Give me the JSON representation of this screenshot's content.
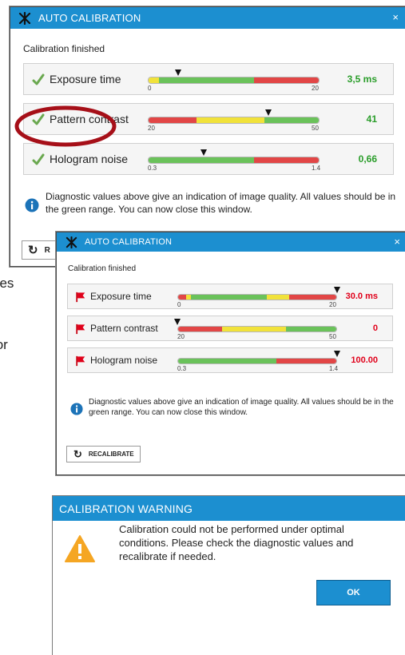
{
  "colors": {
    "accent": "#1c8fd0",
    "good": "#2a9d2a",
    "bad": "#e0001a",
    "green": "#6ac25a",
    "yellow": "#f1e23a",
    "red": "#e24646",
    "annotation": "#a60f18"
  },
  "side_text": {
    "line1": "ues",
    "line2": "for"
  },
  "dialog1": {
    "title": "AUTO CALIBRATION",
    "close": "×",
    "subtitle": "Calibration finished",
    "rows": [
      {
        "label": "Exposure time",
        "status_icon": "check-icon",
        "value": "3,5 ms",
        "value_color": "#2a9d2a",
        "min": 0,
        "max": 20,
        "min_label": "0",
        "max_label": "20",
        "marker": 3.5,
        "segments": [
          {
            "c": "yellow",
            "w": 0.06
          },
          {
            "c": "green",
            "w": 0.56
          },
          {
            "c": "red",
            "w": 0.38
          }
        ]
      },
      {
        "label": "Pattern contrast",
        "status_icon": "check-icon",
        "value": "41",
        "value_color": "#2a9d2a",
        "min": 20,
        "max": 50,
        "min_label": "20",
        "max_label": "50",
        "marker": 41,
        "segments": [
          {
            "c": "red",
            "w": 0.28
          },
          {
            "c": "yellow",
            "w": 0.4
          },
          {
            "c": "green",
            "w": 0.32
          }
        ]
      },
      {
        "label": "Hologram noise",
        "status_icon": "check-icon",
        "value": "0,66",
        "value_color": "#2a9d2a",
        "min": 0.3,
        "max": 1.4,
        "min_label": "0.3",
        "max_label": "1.4",
        "marker": 0.66,
        "segments": [
          {
            "c": "green",
            "w": 0.62
          },
          {
            "c": "red",
            "w": 0.38
          }
        ]
      }
    ],
    "info": "Diagnostic values above give an indication of image quality. All values should be in the green range. You can now close this window.",
    "button_partial": "R"
  },
  "dialog2": {
    "title": "AUTO CALIBRATION",
    "close": "×",
    "subtitle": "Calibration finished",
    "rows": [
      {
        "label": "Exposure time",
        "status_icon": "flag-icon",
        "value": "30.0 ms",
        "value_color": "#e0001a",
        "min": 0,
        "max": 20,
        "min_label": "0",
        "max_label": "20",
        "marker": 20,
        "segments": [
          {
            "c": "red",
            "w": 0.05
          },
          {
            "c": "yellow",
            "w": 0.03
          },
          {
            "c": "green",
            "w": 0.48
          },
          {
            "c": "yellow",
            "w": 0.14
          },
          {
            "c": "red",
            "w": 0.3
          }
        ]
      },
      {
        "label": "Pattern contrast",
        "status_icon": "flag-icon",
        "value": "0",
        "value_color": "#e0001a",
        "min": 20,
        "max": 50,
        "min_label": "20",
        "max_label": "50",
        "marker": 20,
        "segments": [
          {
            "c": "red",
            "w": 0.28
          },
          {
            "c": "yellow",
            "w": 0.4
          },
          {
            "c": "green",
            "w": 0.32
          }
        ]
      },
      {
        "label": "Hologram noise",
        "status_icon": "flag-icon",
        "value": "100.00",
        "value_color": "#e0001a",
        "min": 0.3,
        "max": 1.4,
        "min_label": "0.3",
        "max_label": "1.4",
        "marker": 1.4,
        "segments": [
          {
            "c": "green",
            "w": 0.62
          },
          {
            "c": "red",
            "w": 0.38
          }
        ]
      }
    ],
    "info": "Diagnostic values above give an indication of image quality. All values should be in the green range. You can now close this window.",
    "button": "RECALIBRATE"
  },
  "warning": {
    "title": "CALIBRATION WARNING",
    "icon": "warning-icon",
    "message": "Calibration could not be performed under optimal conditions. Please check the diagnostic values and recalibrate if needed.",
    "ok": "OK"
  }
}
